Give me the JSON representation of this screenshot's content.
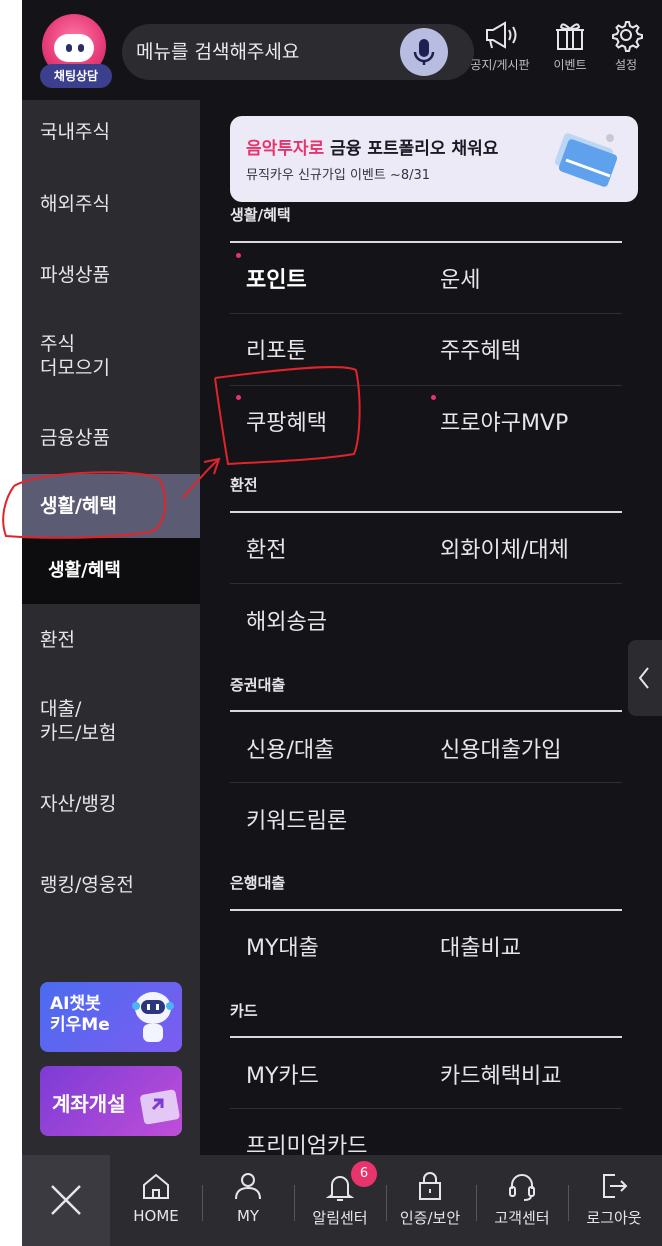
{
  "top": {
    "chatbot_badge": "채팅상담",
    "search_placeholder": "메뉴를 검색해주세요",
    "icons": [
      {
        "label": "공지/게시판",
        "icon": "megaphone-icon"
      },
      {
        "label": "이벤트",
        "icon": "gift-icon"
      },
      {
        "label": "설정",
        "icon": "gear-icon"
      }
    ]
  },
  "leftnav": {
    "items": [
      "국내주식",
      "해외주식",
      "파생상품",
      "주식\n더모으기",
      "금융상품",
      "생활/혜택",
      "환전",
      "대출/\n카드/보험",
      "자산/뱅킹",
      "랭킹/영웅전"
    ],
    "active_sub": "생활/혜택",
    "promo1": {
      "line1": "AI챗봇",
      "line2": "키우Me"
    },
    "promo2": "계좌개설"
  },
  "banner": {
    "accent": "음악투자로",
    "title_rest": " 금융 포트폴리오 채워요",
    "subtitle": "뮤직카우 신규가입 이벤트 ~8/31"
  },
  "sections": [
    {
      "title": "생활/혜택",
      "items": [
        "포인트",
        "운세",
        "리포툰",
        "주주혜택",
        "쿠팡혜택",
        "프로야구MVP"
      ]
    },
    {
      "title": "환전",
      "items": [
        "환전",
        "외화이체/대체",
        "해외송금"
      ]
    },
    {
      "title": "증권대출",
      "items": [
        "신용/대출",
        "신용대출가입",
        "키워드림론"
      ]
    },
    {
      "title": "은행대출",
      "items": [
        "MY대출",
        "대출비교"
      ]
    },
    {
      "title": "카드",
      "items": [
        "MY카드",
        "카드혜택비교",
        "프리미엄카드"
      ]
    }
  ],
  "bottombar": {
    "tabs": [
      {
        "label": "HOME",
        "icon": "home-icon"
      },
      {
        "label": "MY",
        "icon": "person-icon"
      },
      {
        "label": "알림센터",
        "icon": "bell-icon",
        "badge": "6"
      },
      {
        "label": "인증/보안",
        "icon": "lock-icon"
      },
      {
        "label": "고객센터",
        "icon": "headset-icon"
      },
      {
        "label": "로그아웃",
        "icon": "logout-icon"
      }
    ]
  },
  "colors": {
    "accent": "#e8336c",
    "background": "#141418",
    "panel": "#2b2b30",
    "active": "#5b5b73"
  }
}
